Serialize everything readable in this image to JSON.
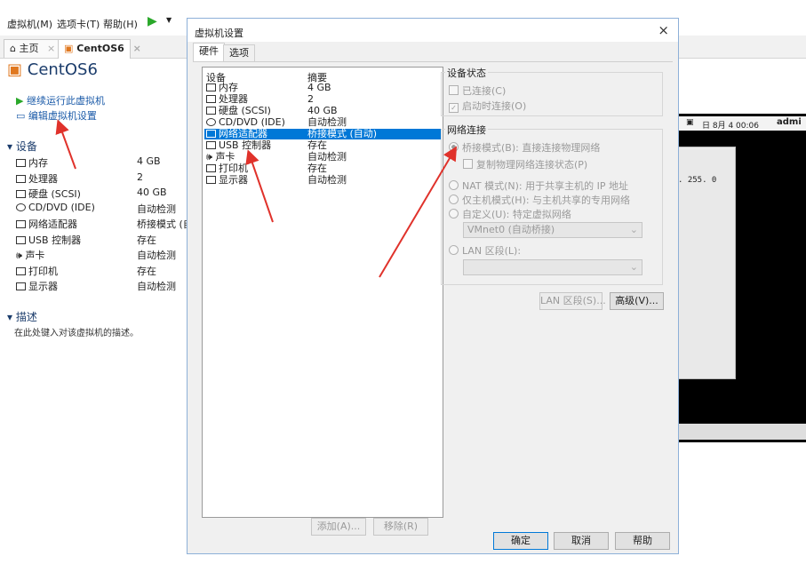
{
  "menubar": {
    "items": [
      "虚拟机(M)",
      "选项卡(T)",
      "帮助(H)"
    ],
    "play_label": "▶"
  },
  "tabs": [
    {
      "label": "主页",
      "close": "×"
    },
    {
      "label": "CentOS6",
      "close": "×"
    }
  ],
  "vm": {
    "title": "CentOS6",
    "actions": [
      "继续运行此虚拟机",
      "编辑虚拟机设置"
    ],
    "devices_header": "设备",
    "devices": [
      {
        "name": "内存",
        "summary": "4 GB"
      },
      {
        "name": "处理器",
        "summary": "2"
      },
      {
        "name": "硬盘 (SCSI)",
        "summary": "40 GB"
      },
      {
        "name": "CD/DVD (IDE)",
        "summary": "自动检测"
      },
      {
        "name": "网络适配器",
        "summary": "桥接模式 (自"
      },
      {
        "name": "USB 控制器",
        "summary": "存在"
      },
      {
        "name": "声卡",
        "summary": "自动检测"
      },
      {
        "name": "打印机",
        "summary": "存在"
      },
      {
        "name": "显示器",
        "summary": "自动检测"
      }
    ],
    "description_header": "描述",
    "description_placeholder": "在此处键入对该虚拟机的描述。"
  },
  "console": {
    "clock": "日 8月  4 00:06",
    "user": "admi",
    "terminal_text": ". 255. 0"
  },
  "dialog": {
    "title": "虚拟机设置",
    "close": "×",
    "tabs": [
      "硬件",
      "选项"
    ],
    "list_headers": {
      "device": "设备",
      "summary": "摘要"
    },
    "list": [
      {
        "name": "内存",
        "summary": "4 GB",
        "selected": false
      },
      {
        "name": "处理器",
        "summary": "2",
        "selected": false
      },
      {
        "name": "硬盘 (SCSI)",
        "summary": "40 GB",
        "selected": false
      },
      {
        "name": "CD/DVD (IDE)",
        "summary": "自动检测",
        "selected": false
      },
      {
        "name": "网络适配器",
        "summary": "桥接模式 (自动)",
        "selected": true
      },
      {
        "name": "USB 控制器",
        "summary": "存在",
        "selected": false
      },
      {
        "name": "声卡",
        "summary": "自动检测",
        "selected": false
      },
      {
        "name": "打印机",
        "summary": "存在",
        "selected": false
      },
      {
        "name": "显示器",
        "summary": "自动检测",
        "selected": false
      }
    ],
    "add_button": "添加(A)...",
    "remove_button": "移除(R)",
    "device_status": {
      "title": "设备状态",
      "connected": "已连接(C)",
      "connect_at_power_on": "启动时连接(O)"
    },
    "network": {
      "title": "网络连接",
      "bridged": "桥接模式(B): 直接连接物理网络",
      "replicate": "复制物理网络连接状态(P)",
      "nat": "NAT 模式(N): 用于共享主机的 IP 地址",
      "host_only": "仅主机模式(H): 与主机共享的专用网络",
      "custom": "自定义(U): 特定虚拟网络",
      "custom_select": "VMnet0 (自动桥接)",
      "lan": "LAN 区段(L):",
      "lan_select": ""
    },
    "lan_segments_button": "LAN 区段(S)...",
    "advanced_button": "高级(V)...",
    "ok_button": "确定",
    "cancel_button": "取消",
    "help_button": "帮助"
  },
  "colors": {
    "selection": "#0078d7",
    "link": "#1a5aa8",
    "arrow": "#e0322b"
  }
}
